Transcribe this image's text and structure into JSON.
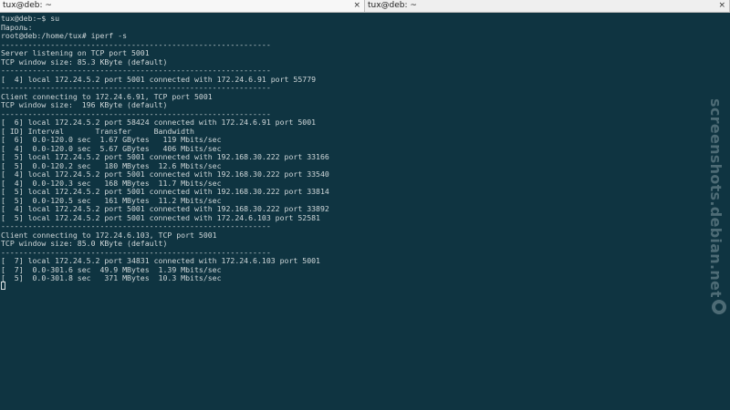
{
  "tabs": [
    {
      "title": "tux@deb: ~",
      "close_label": "×"
    },
    {
      "title": "tux@deb: ~",
      "close_label": "×"
    }
  ],
  "terminal": {
    "lines": [
      "tux@deb:~$ su",
      "Пароль:",
      "root@deb:/home/tux# iperf -s",
      "------------------------------------------------------------",
      "Server listening on TCP port 5001",
      "TCP window size: 85.3 KByte (default)",
      "------------------------------------------------------------",
      "[  4] local 172.24.5.2 port 5001 connected with 172.24.6.91 port 55779",
      "------------------------------------------------------------",
      "Client connecting to 172.24.6.91, TCP port 5001",
      "TCP window size:  196 KByte (default)",
      "------------------------------------------------------------",
      "[  6] local 172.24.5.2 port 58424 connected with 172.24.6.91 port 5001",
      "[ ID] Interval       Transfer     Bandwidth",
      "[  6]  0.0-120.0 sec  1.67 GBytes   119 Mbits/sec",
      "[  4]  0.0-120.0 sec  5.67 GBytes   406 Mbits/sec",
      "[  5] local 172.24.5.2 port 5001 connected with 192.168.30.222 port 33166",
      "[  5]  0.0-120.2 sec   180 MBytes  12.6 Mbits/sec",
      "[  4] local 172.24.5.2 port 5001 connected with 192.168.30.222 port 33540",
      "[  4]  0.0-120.3 sec   168 MBytes  11.7 Mbits/sec",
      "[  5] local 172.24.5.2 port 5001 connected with 192.168.30.222 port 33814",
      "[  5]  0.0-120.5 sec   161 MBytes  11.2 Mbits/sec",
      "[  4] local 172.24.5.2 port 5001 connected with 192.168.30.222 port 33892",
      "[  5] local 172.24.5.2 port 5001 connected with 172.24.6.103 port 52581",
      "------------------------------------------------------------",
      "Client connecting to 172.24.6.103, TCP port 5001",
      "TCP window size: 85.0 KByte (default)",
      "------------------------------------------------------------",
      "[  7] local 172.24.5.2 port 34831 connected with 172.24.6.103 port 5001",
      "[  7]  0.0-301.6 sec  49.9 MBytes  1.39 Mbits/sec",
      "[  5]  0.0-301.8 sec   371 MBytes  10.3 Mbits/sec"
    ]
  },
  "watermark": {
    "text": "screenshots.debian.net"
  },
  "colors": {
    "background": "#0f3441",
    "text": "#cfd7d9",
    "tabbar": "#ececec"
  }
}
